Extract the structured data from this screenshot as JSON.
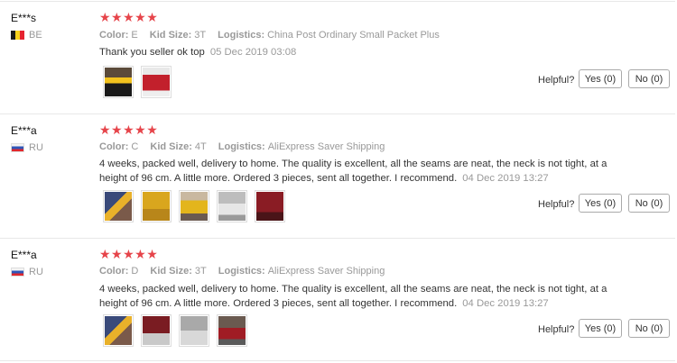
{
  "reviews": [
    {
      "user": "E***s",
      "country": "BE",
      "stars": "★★★★★",
      "color_label": "Color:",
      "color": "E",
      "size_label": "Kid Size:",
      "size": "3T",
      "logistics_label": "Logistics:",
      "logistics": "China Post Ordinary Small Packet Plus",
      "text": "Thank you seller ok top",
      "date": "05 Dec 2019 03:08",
      "helpful": "Helpful?",
      "yes": "Yes (0)",
      "no": "No (0)"
    },
    {
      "user": "E***a",
      "country": "RU",
      "stars": "★★★★★",
      "color_label": "Color:",
      "color": "C",
      "size_label": "Kid Size:",
      "size": "4T",
      "logistics_label": "Logistics:",
      "logistics": "AliExpress Saver Shipping",
      "text": "4 weeks, packed well, delivery to home. The quality is excellent, all the seams are neat, the neck is not tight, at a height of 96 cm. A little more. Ordered 3 pieces, sent all together. I recommend.",
      "date": "04 Dec 2019 13:27",
      "helpful": "Helpful?",
      "yes": "Yes (0)",
      "no": "No (0)"
    },
    {
      "user": "E***a",
      "country": "RU",
      "stars": "★★★★★",
      "color_label": "Color:",
      "color": "D",
      "size_label": "Kid Size:",
      "size": "3T",
      "logistics_label": "Logistics:",
      "logistics": "AliExpress Saver Shipping",
      "text": "4 weeks, packed well, delivery to home. The quality is excellent, all the seams are neat, the neck is not tight, at a height of 96 cm. A little more. Ordered 3 pieces, sent all together. I recommend.",
      "date": "04 Dec 2019 13:27",
      "helpful": "Helpful?",
      "yes": "Yes (0)",
      "no": "No (0)"
    }
  ]
}
